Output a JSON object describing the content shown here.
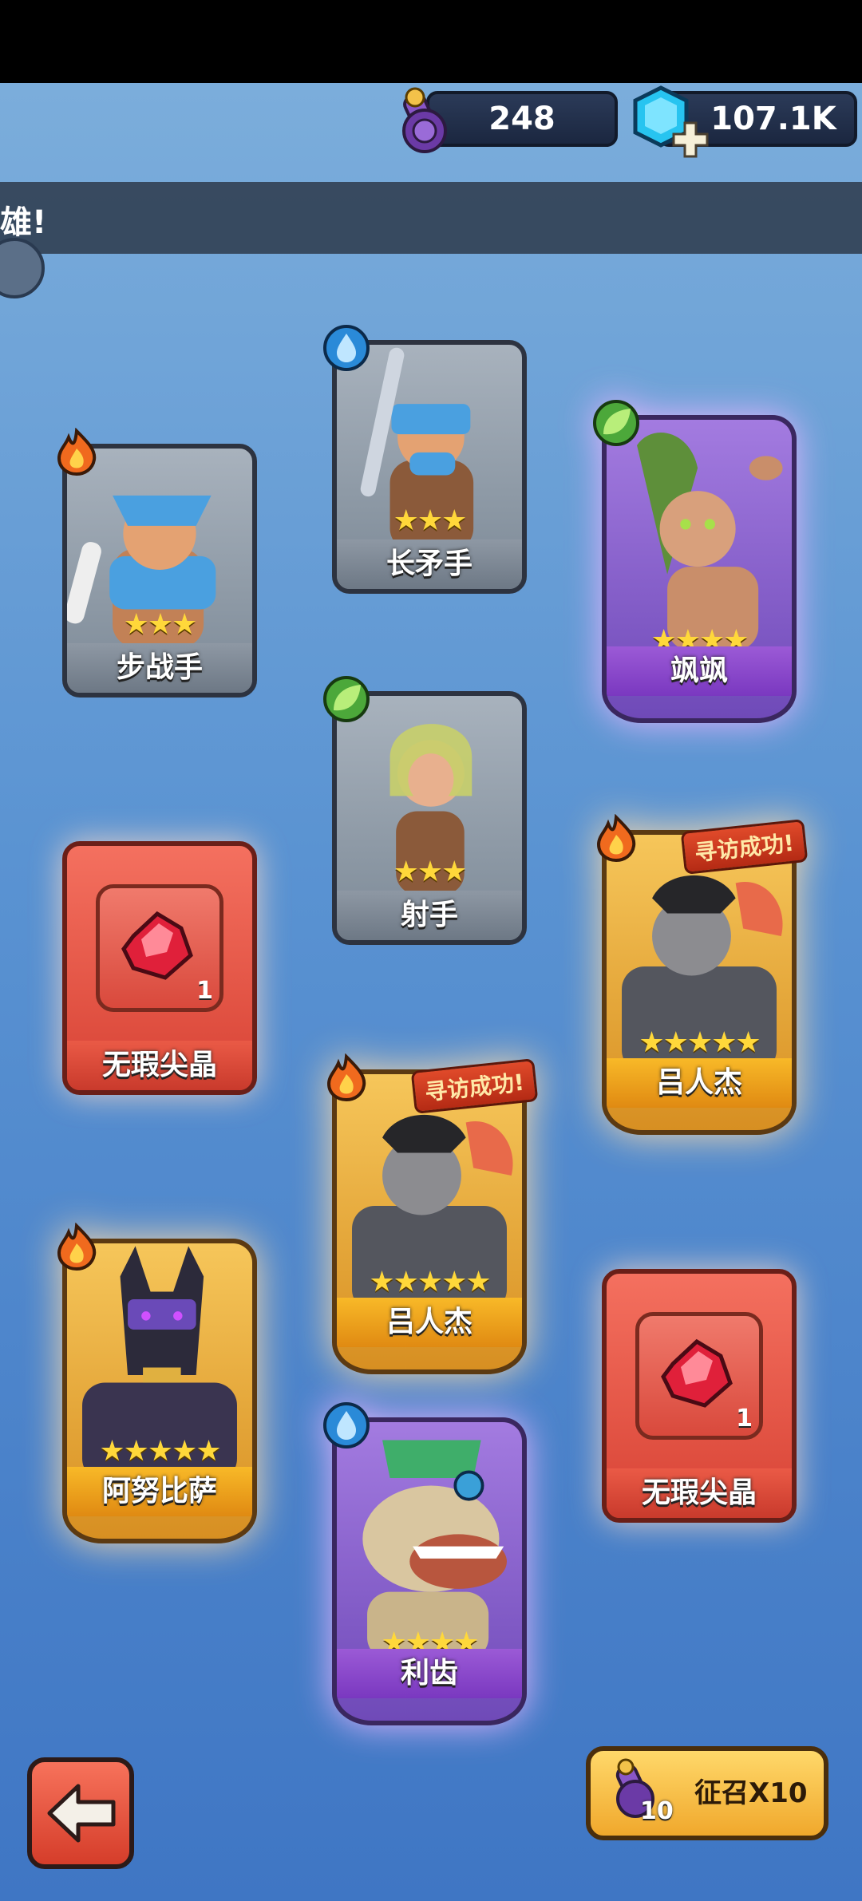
{
  "resources": {
    "scrolls": "248",
    "gems": "107.1K"
  },
  "banner": {
    "text": "雄!"
  },
  "cards": [
    {
      "id": "infantry",
      "name": "步战手",
      "stars": "★★★",
      "rarity": "gray",
      "element": "fire-icon"
    },
    {
      "id": "spearman",
      "name": "长矛手",
      "stars": "★★★",
      "rarity": "gray",
      "element": "water-icon"
    },
    {
      "id": "sasa",
      "name": "飒飒",
      "stars": "★★★★",
      "rarity": "purple",
      "element": "leaf-icon"
    },
    {
      "id": "archer",
      "name": "射手",
      "stars": "★★★",
      "rarity": "gray",
      "element": "leaf-icon"
    },
    {
      "id": "crystal-1",
      "name": "无瑕尖晶",
      "count": "1",
      "rarity": "red"
    },
    {
      "id": "lu-renjie-1",
      "name": "吕人杰",
      "stars": "★★★★★",
      "rarity": "gold",
      "element": "fire-icon",
      "badge": "寻访成功!"
    },
    {
      "id": "lu-renjie-2",
      "name": "吕人杰",
      "stars": "★★★★★",
      "rarity": "gold",
      "element": "fire-icon",
      "badge": "寻访成功!"
    },
    {
      "id": "anubisa",
      "name": "阿努比萨",
      "stars": "★★★★★",
      "rarity": "gold",
      "element": "fire-icon"
    },
    {
      "id": "crystal-2",
      "name": "无瑕尖晶",
      "count": "1",
      "rarity": "red"
    },
    {
      "id": "lichi",
      "name": "利齿",
      "stars": "★★★★",
      "rarity": "purple",
      "element": "water-icon"
    }
  ],
  "buttons": {
    "summon_label": "征召X10",
    "summon_cost": "10"
  },
  "colors": {
    "background": "#5a93d2",
    "gold": "#f0a82c",
    "purple": "#7a38c0",
    "red": "#d84335",
    "gray": "#7d8a97"
  }
}
